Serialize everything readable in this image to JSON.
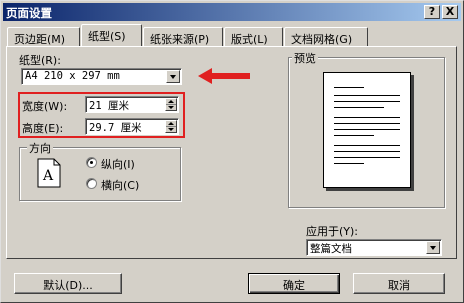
{
  "window": {
    "title": "页面设置",
    "help_button": "?",
    "close_button": "X"
  },
  "tabs": [
    {
      "label": "页边距(M)"
    },
    {
      "label": "纸型(S)"
    },
    {
      "label": "纸张来源(P)"
    },
    {
      "label": "版式(L)"
    },
    {
      "label": "文档网格(G)"
    }
  ],
  "paper": {
    "size_label": "纸型(R):",
    "size_value": "A4 210 x 297 mm",
    "width_label": "宽度(W):",
    "width_value": "21 厘米",
    "height_label": "高度(E):",
    "height_value": "29.7 厘米"
  },
  "orientation": {
    "title": "方向",
    "icon_letter": "A",
    "portrait_label": "纵向(I)",
    "landscape_label": "横向(C)",
    "selected": "portrait"
  },
  "preview": {
    "title": "预览",
    "apply_label": "应用于(Y):",
    "apply_value": "整篇文档"
  },
  "buttons": {
    "default": "默认(D)...",
    "ok": "确定",
    "cancel": "取消"
  },
  "colors": {
    "highlight": "#e02020",
    "title_bar": "#0a246a"
  }
}
